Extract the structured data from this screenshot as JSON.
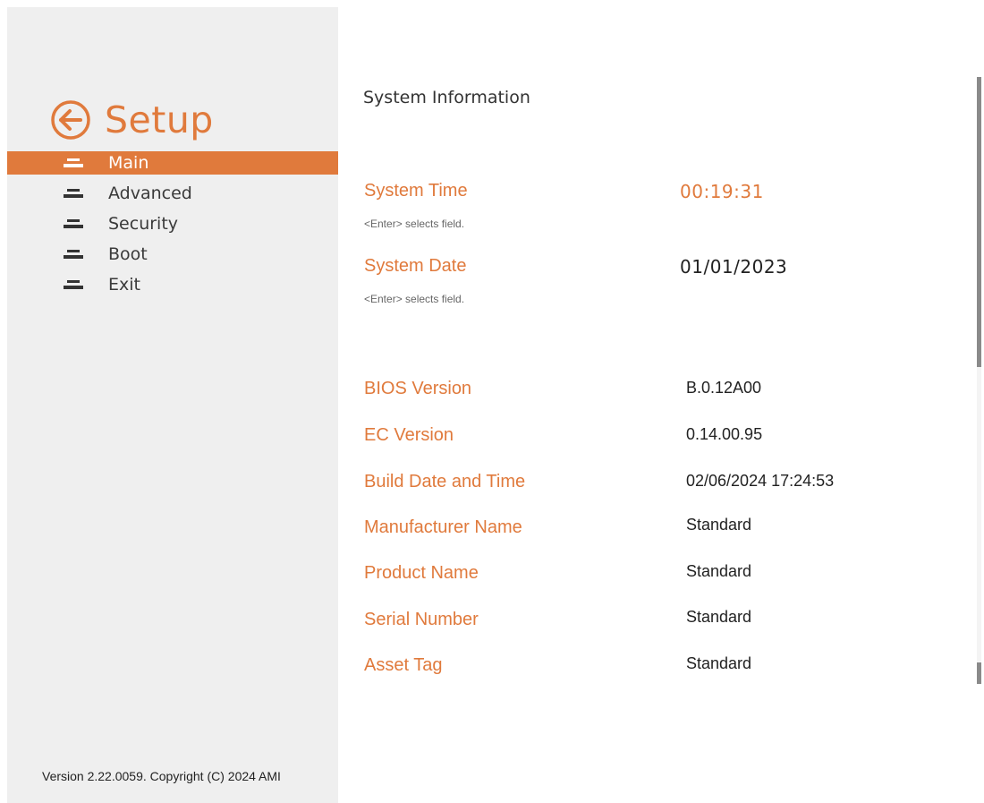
{
  "setup": {
    "title": "Setup",
    "back_icon": "circle-arrow-left-icon",
    "accent_color": "#e07a3c"
  },
  "sidebar": {
    "items": [
      {
        "label": "Main",
        "icon": "menu-tab-icon",
        "active": true
      },
      {
        "label": "Advanced",
        "icon": "menu-tab-icon",
        "active": false
      },
      {
        "label": "Security",
        "icon": "menu-tab-icon",
        "active": false
      },
      {
        "label": "Boot",
        "icon": "menu-tab-icon",
        "active": false
      },
      {
        "label": "Exit",
        "icon": "menu-tab-icon",
        "active": false
      }
    ]
  },
  "main": {
    "section_title": "System Information",
    "system_time": {
      "label": "System Time",
      "value": "00:19:31",
      "hint": "<Enter> selects field."
    },
    "system_date": {
      "label": "System Date",
      "value": "01/01/2023",
      "hint": "<Enter> selects field."
    },
    "info": [
      {
        "label": "BIOS Version",
        "value": "B.0.12A00"
      },
      {
        "label": "EC Version",
        "value": "0.14.00.95"
      },
      {
        "label": "Build Date and Time",
        "value": "02/06/2024 17:24:53"
      },
      {
        "label": "Manufacturer Name",
        "value": "Standard"
      },
      {
        "label": "Product Name",
        "value": "Standard"
      },
      {
        "label": "Serial Number",
        "value": "Standard"
      },
      {
        "label": "Asset Tag",
        "value": "Standard"
      }
    ]
  },
  "footer": {
    "copyright": "Version 2.22.0059. Copyright (C) 2024 AMI"
  }
}
